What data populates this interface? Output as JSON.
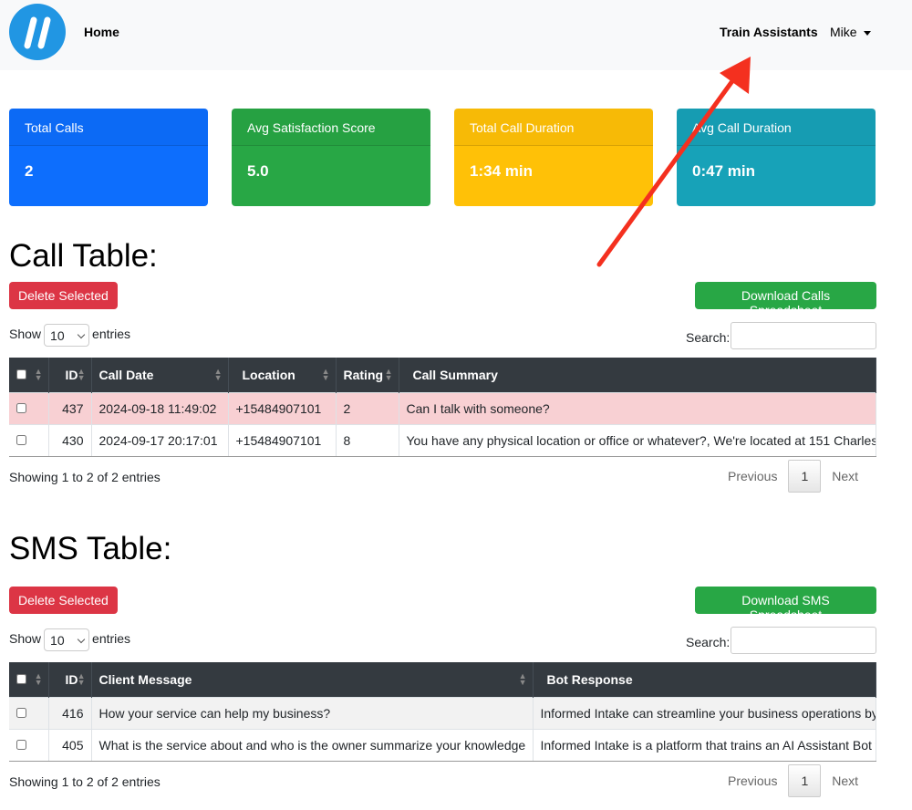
{
  "nav": {
    "home": "Home",
    "train": "Train Assistants",
    "user": "Mike"
  },
  "cards": [
    {
      "title": "Total Calls",
      "value": "2",
      "color": "#0d6efd"
    },
    {
      "title": "Avg Satisfaction Score",
      "value": "5.0",
      "color": "#28a745"
    },
    {
      "title": "Total Call Duration",
      "value": "1:34 min",
      "color": "#ffc107"
    },
    {
      "title": "Avg Call Duration",
      "value": "0:47 min",
      "color": "#17a2b8"
    }
  ],
  "calls": {
    "heading": "Call Table:",
    "delete": "Delete Selected",
    "download": "Download Calls Spreadsheet",
    "show": "Show",
    "entries_count": "10",
    "entries": "entries",
    "search": "Search:",
    "columns": [
      "ID",
      "Call Date",
      "Location",
      "Rating",
      "Call Summary"
    ],
    "rows": [
      {
        "id": "437",
        "date": "2024-09-18 11:49:02",
        "location": "+15484907101",
        "rating": "2",
        "summary": "Can I talk with someone?"
      },
      {
        "id": "430",
        "date": "2024-09-17 20:17:01",
        "location": "+15484907101",
        "rating": "8",
        "summary": "You have any physical location or office or whatever?, We're located at 151 Charles"
      }
    ],
    "info": "Showing 1 to 2 of 2 entries",
    "prev": "Previous",
    "page": "1",
    "next": "Next"
  },
  "sms": {
    "heading": "SMS Table:",
    "delete": "Delete Selected",
    "download": "Download SMS Spreadsheet",
    "show": "Show",
    "entries_count": "10",
    "entries": "entries",
    "search": "Search:",
    "columns": [
      "ID",
      "Client Message",
      "Bot Response"
    ],
    "rows": [
      {
        "id": "416",
        "message": "How your service can help my business?",
        "response": "Informed Intake can streamline your business operations by"
      },
      {
        "id": "405",
        "message": "What is the service about and who is the owner summarize your knowledge",
        "response": "Informed Intake is a platform that trains an AI Assistant Bot t"
      }
    ],
    "info": "Showing 1 to 2 of 2 entries",
    "prev": "Previous",
    "page": "1",
    "next": "Next"
  }
}
